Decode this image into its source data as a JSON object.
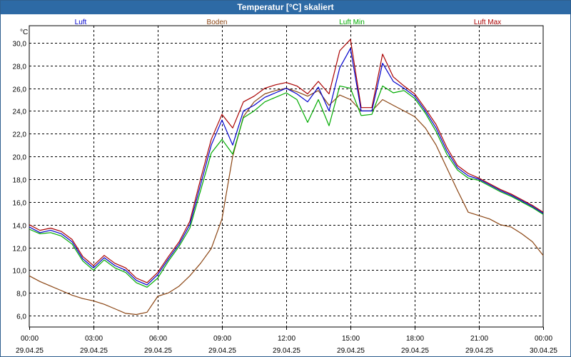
{
  "window": {
    "title": "Temperatur [°C] skaliert"
  },
  "chart_data": {
    "type": "line",
    "title": "Temperatur [°C] skaliert",
    "ylabel": "°C",
    "xlabel": "",
    "ylim": [
      5.0,
      31.5
    ],
    "xlim_hours": [
      0,
      24
    ],
    "grid": true,
    "legend_placement": "top",
    "y_ticks": [
      "6,0",
      "8,0",
      "10,0",
      "12,0",
      "14,0",
      "16,0",
      "18,0",
      "20,0",
      "22,0",
      "24,0",
      "26,0",
      "28,0",
      "30,0"
    ],
    "x_ticks": [
      {
        "time": "00:00",
        "date": "29.04.25"
      },
      {
        "time": "03:00",
        "date": "29.04.25"
      },
      {
        "time": "06:00",
        "date": "29.04.25"
      },
      {
        "time": "09:00",
        "date": "29.04.25"
      },
      {
        "time": "12:00",
        "date": "29.04.25"
      },
      {
        "time": "15:00",
        "date": "29.04.25"
      },
      {
        "time": "18:00",
        "date": "29.04.25"
      },
      {
        "time": "21:00",
        "date": "29.04.25"
      },
      {
        "time": "00:00",
        "date": "30.04.25"
      }
    ],
    "x_hours": [
      0,
      0.5,
      1,
      1.5,
      2,
      2.5,
      3,
      3.5,
      4,
      4.5,
      5,
      5.5,
      6,
      6.5,
      7,
      7.5,
      8,
      8.5,
      9,
      9.5,
      10,
      10.5,
      11,
      11.5,
      12,
      12.5,
      13,
      13.5,
      14,
      14.5,
      15,
      15.5,
      16,
      16.5,
      17,
      17.5,
      18,
      18.5,
      19,
      19.5,
      20,
      20.5,
      21,
      21.5,
      22,
      22.5,
      23,
      23.5,
      24
    ],
    "series": [
      {
        "name": "Luft",
        "color": "#0000cc",
        "values": [
          13.8,
          13.3,
          13.5,
          13.2,
          12.5,
          11.0,
          10.2,
          11.1,
          10.4,
          10.0,
          9.1,
          8.7,
          9.6,
          11.0,
          12.3,
          14.0,
          17.5,
          21.0,
          23.2,
          21.0,
          24.0,
          24.5,
          25.2,
          25.6,
          26.0,
          25.5,
          24.8,
          26.1,
          24.0,
          27.8,
          29.5,
          24.0,
          24.0,
          28.2,
          26.6,
          26.0,
          25.3,
          24.0,
          22.5,
          20.5,
          19.0,
          18.3,
          18.0,
          17.5,
          17.0,
          16.6,
          16.1,
          15.6,
          15.0
        ]
      },
      {
        "name": "Boden",
        "color": "#8b4513",
        "values": [
          9.5,
          9.0,
          8.6,
          8.2,
          7.8,
          7.5,
          7.3,
          7.0,
          6.6,
          6.2,
          6.1,
          6.3,
          7.7,
          8.0,
          8.6,
          9.5,
          10.6,
          11.9,
          14.5,
          20.0,
          23.5,
          24.8,
          25.5,
          25.8,
          26.0,
          25.7,
          25.3,
          25.8,
          24.5,
          25.4,
          25.0,
          24.0,
          24.0,
          25.0,
          24.5,
          24.0,
          23.5,
          22.5,
          21.0,
          19.0,
          17.0,
          15.1,
          14.8,
          14.5,
          14.0,
          13.8,
          13.2,
          12.5,
          11.3
        ]
      },
      {
        "name": "Luft Min",
        "color": "#00aa00",
        "values": [
          13.6,
          13.2,
          13.3,
          13.0,
          12.3,
          10.8,
          10.0,
          10.9,
          10.2,
          9.8,
          8.9,
          8.5,
          9.3,
          10.8,
          12.1,
          13.7,
          17.0,
          20.3,
          21.5,
          20.2,
          23.4,
          24.0,
          24.8,
          25.2,
          25.6,
          25.0,
          23.0,
          25.0,
          22.7,
          26.2,
          26.0,
          23.6,
          23.7,
          26.2,
          25.6,
          25.8,
          25.1,
          23.8,
          22.2,
          20.2,
          18.8,
          18.1,
          17.9,
          17.4,
          16.9,
          16.5,
          16.0,
          15.5,
          14.9
        ]
      },
      {
        "name": "Luft Max",
        "color": "#aa0000",
        "values": [
          14.0,
          13.5,
          13.7,
          13.4,
          12.7,
          11.2,
          10.4,
          11.3,
          10.6,
          10.2,
          9.3,
          8.9,
          9.8,
          11.2,
          12.5,
          14.3,
          18.0,
          21.5,
          23.7,
          22.5,
          24.8,
          25.3,
          26.0,
          26.3,
          26.5,
          26.2,
          25.5,
          26.6,
          25.5,
          29.3,
          30.3,
          24.3,
          24.3,
          29.0,
          27.0,
          26.2,
          25.5,
          24.2,
          22.8,
          20.8,
          19.2,
          18.5,
          18.1,
          17.6,
          17.1,
          16.7,
          16.2,
          15.7,
          15.1
        ]
      }
    ]
  }
}
